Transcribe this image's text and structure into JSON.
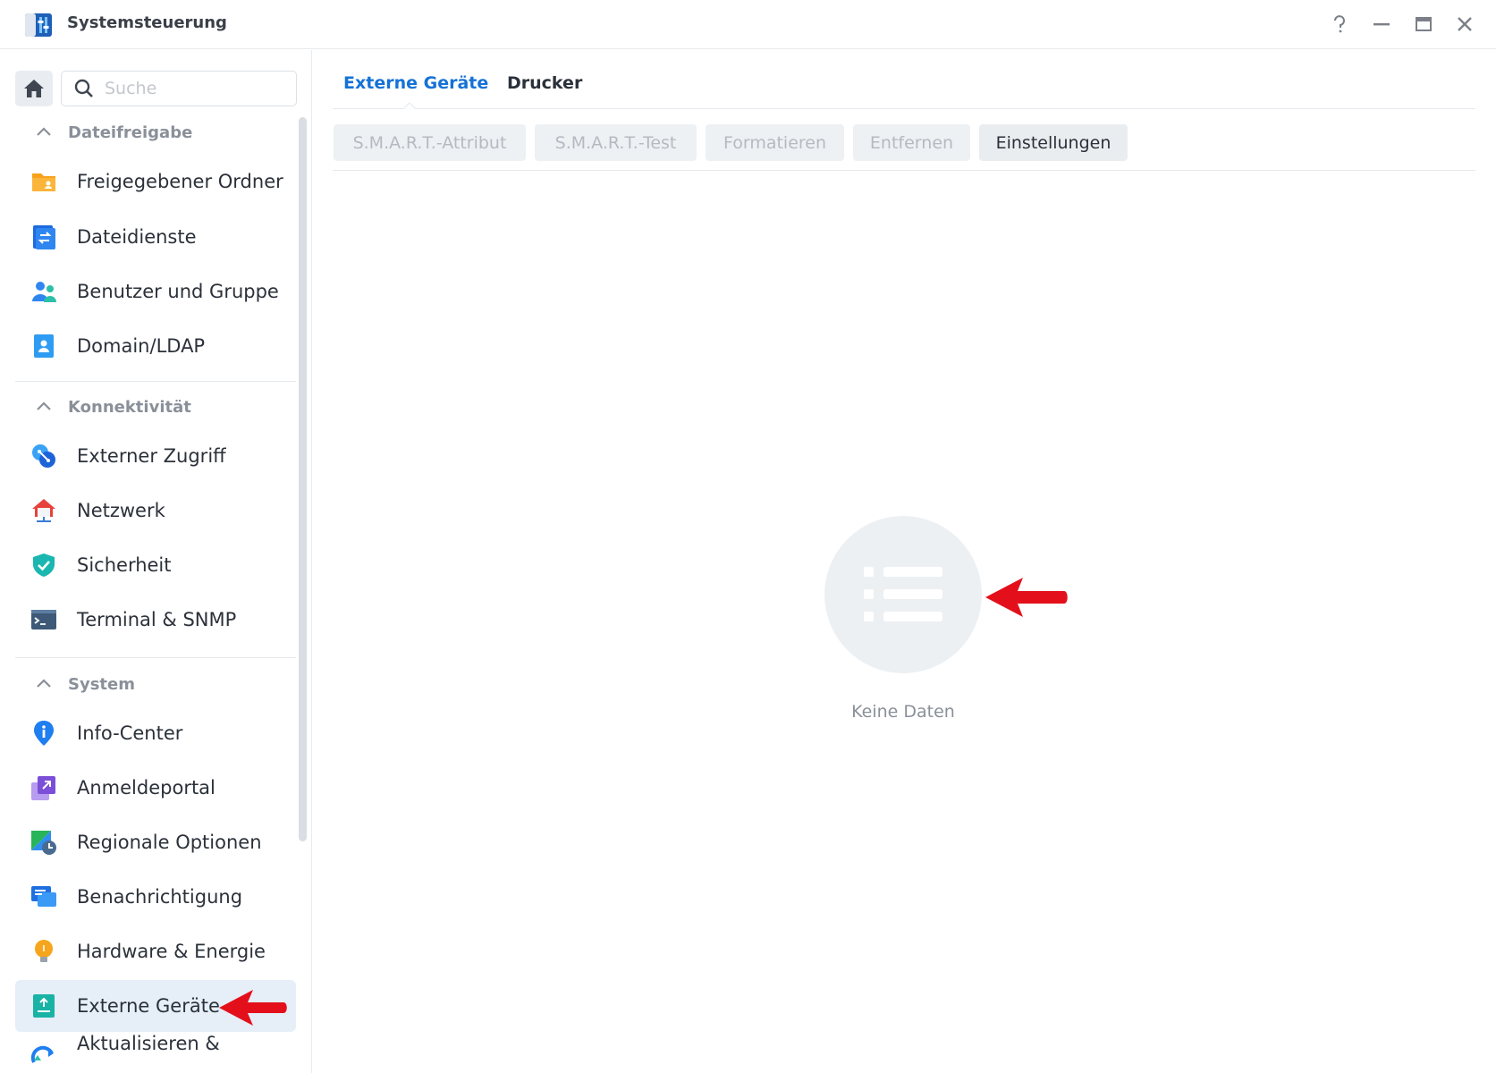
{
  "window": {
    "title": "Systemsteuerung",
    "controls": [
      "help-icon",
      "minimize-icon",
      "maximize-icon",
      "close-icon"
    ]
  },
  "sidebar": {
    "search": {
      "placeholder": "Suche",
      "value": ""
    },
    "sections": [
      {
        "title": "Dateifreigabe",
        "items": [
          {
            "label": "Freigegebener Ordner",
            "icon": "shared-folder-icon"
          },
          {
            "label": "Dateidienste",
            "icon": "file-services-icon"
          },
          {
            "label": "Benutzer und Gruppe",
            "icon": "users-icon"
          },
          {
            "label": "Domain/LDAP",
            "icon": "domain-ldap-icon"
          }
        ]
      },
      {
        "title": "Konnektivität",
        "items": [
          {
            "label": "Externer Zugriff",
            "icon": "external-access-icon"
          },
          {
            "label": "Netzwerk",
            "icon": "network-icon"
          },
          {
            "label": "Sicherheit",
            "icon": "security-shield-icon"
          },
          {
            "label": "Terminal & SNMP",
            "icon": "terminal-icon"
          }
        ]
      },
      {
        "title": "System",
        "items": [
          {
            "label": "Info-Center",
            "icon": "info-icon"
          },
          {
            "label": "Anmeldeportal",
            "icon": "login-portal-icon"
          },
          {
            "label": "Regionale Optionen",
            "icon": "regional-options-icon"
          },
          {
            "label": "Benachrichtigung",
            "icon": "notification-icon"
          },
          {
            "label": "Hardware & Energie",
            "icon": "hardware-power-icon"
          },
          {
            "label": "Externe Geräte",
            "icon": "external-devices-icon",
            "active": true
          },
          {
            "label": "Aktualisieren &",
            "icon": "update-icon"
          }
        ]
      }
    ]
  },
  "main": {
    "tabs": [
      {
        "label": "Externe Geräte",
        "active": true
      },
      {
        "label": "Drucker",
        "active": false
      }
    ],
    "toolbar": [
      {
        "label": "S.M.A.R.T.-Attribut",
        "enabled": false
      },
      {
        "label": "S.M.A.R.T.-Test",
        "enabled": false
      },
      {
        "label": "Formatieren",
        "enabled": false
      },
      {
        "label": "Entfernen",
        "enabled": false
      },
      {
        "label": "Einstellungen",
        "enabled": true
      }
    ],
    "empty_state": {
      "icon": "list-icon",
      "text": "Keine Daten"
    }
  },
  "colors": {
    "accent": "#1572d6",
    "active_item_bg": "#e6eef8",
    "annotation_arrow": "#e3101b"
  }
}
